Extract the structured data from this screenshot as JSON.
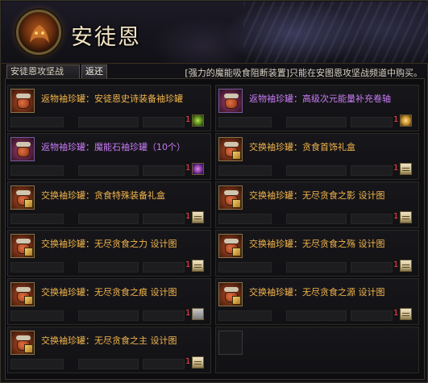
{
  "header": {
    "title": "安徒恩"
  },
  "tabs": [
    {
      "label": "安徒恩攻坚战"
    },
    {
      "label": "返还"
    }
  ],
  "notice": "[强力的魔能吸食阻断装置]只能在安图恩攻坚战频道中购买。",
  "items": [
    {
      "name": "返物袖珍罐：安徒恩史诗装备袖珍罐",
      "color": "#f3b54c",
      "qty": "1",
      "icon": "jar-icon",
      "thumb": "green-orb-icon"
    },
    {
      "name": "返物袖珍罐：高级次元能量补充卷轴",
      "color": "#c97cf5",
      "qty": "1",
      "icon": "jar-icon",
      "thumb": "gold-orb-icon"
    },
    {
      "name": "返物袖珍罐：魔能石袖珍罐（10个）",
      "color": "#c97cf5",
      "qty": "1",
      "icon": "jar-icon",
      "thumb": "violet-orb-icon"
    },
    {
      "name": "交换袖珍罐：贪食首饰礼盒",
      "color": "#f3b54c",
      "qty": "1",
      "icon": "jar-icon",
      "thumb": "card-icon"
    },
    {
      "name": "交换袖珍罐：贪食特殊装备礼盒",
      "color": "#f3b54c",
      "qty": "1",
      "icon": "jar-icon",
      "thumb": "card-icon"
    },
    {
      "name": "交换袖珍罐：无尽贪食之影 设计图",
      "color": "#f3b54c",
      "qty": "1",
      "icon": "jar-icon",
      "thumb": "card-icon"
    },
    {
      "name": "交换袖珍罐：无尽贪食之力 设计图",
      "color": "#f3b54c",
      "qty": "1",
      "icon": "jar-icon",
      "thumb": "card-icon"
    },
    {
      "name": "交换袖珍罐：无尽贪食之殇 设计图",
      "color": "#f3b54c",
      "qty": "1",
      "icon": "jar-icon",
      "thumb": "card-icon"
    },
    {
      "name": "交换袖珍罐：无尽贪食之痕 设计图",
      "color": "#f3b54c",
      "qty": "1",
      "icon": "jar-icon",
      "thumb": "grey-card-icon"
    },
    {
      "name": "交换袖珍罐：无尽贪食之源 设计图",
      "color": "#f3b54c",
      "qty": "1",
      "icon": "jar-icon",
      "thumb": "card-icon"
    },
    {
      "name": "交换袖珍罐：无尽贪食之主 设计图",
      "color": "#f3b54c",
      "qty": "1",
      "icon": "jar-icon",
      "thumb": "card-icon"
    }
  ]
}
